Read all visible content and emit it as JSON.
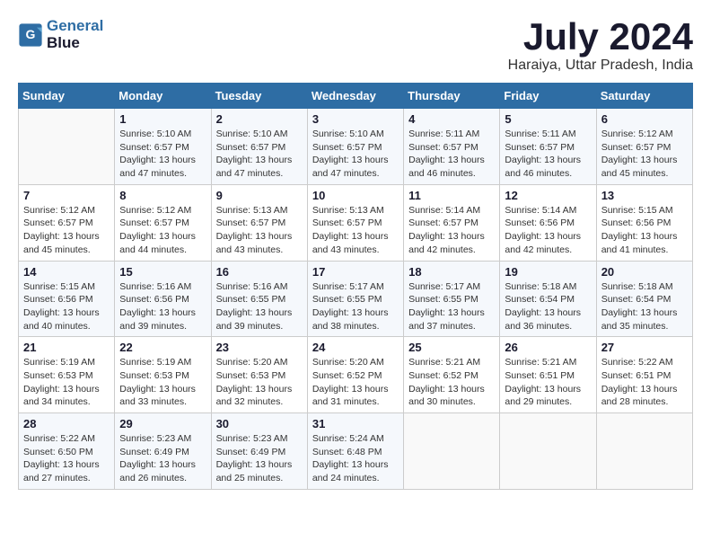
{
  "header": {
    "logo_line1": "General",
    "logo_line2": "Blue",
    "month_year": "July 2024",
    "location": "Haraiya, Uttar Pradesh, India"
  },
  "weekdays": [
    "Sunday",
    "Monday",
    "Tuesday",
    "Wednesday",
    "Thursday",
    "Friday",
    "Saturday"
  ],
  "weeks": [
    [
      {
        "day": "",
        "info": ""
      },
      {
        "day": "1",
        "info": "Sunrise: 5:10 AM\nSunset: 6:57 PM\nDaylight: 13 hours\nand 47 minutes."
      },
      {
        "day": "2",
        "info": "Sunrise: 5:10 AM\nSunset: 6:57 PM\nDaylight: 13 hours\nand 47 minutes."
      },
      {
        "day": "3",
        "info": "Sunrise: 5:10 AM\nSunset: 6:57 PM\nDaylight: 13 hours\nand 47 minutes."
      },
      {
        "day": "4",
        "info": "Sunrise: 5:11 AM\nSunset: 6:57 PM\nDaylight: 13 hours\nand 46 minutes."
      },
      {
        "day": "5",
        "info": "Sunrise: 5:11 AM\nSunset: 6:57 PM\nDaylight: 13 hours\nand 46 minutes."
      },
      {
        "day": "6",
        "info": "Sunrise: 5:12 AM\nSunset: 6:57 PM\nDaylight: 13 hours\nand 45 minutes."
      }
    ],
    [
      {
        "day": "7",
        "info": "Sunrise: 5:12 AM\nSunset: 6:57 PM\nDaylight: 13 hours\nand 45 minutes."
      },
      {
        "day": "8",
        "info": "Sunrise: 5:12 AM\nSunset: 6:57 PM\nDaylight: 13 hours\nand 44 minutes."
      },
      {
        "day": "9",
        "info": "Sunrise: 5:13 AM\nSunset: 6:57 PM\nDaylight: 13 hours\nand 43 minutes."
      },
      {
        "day": "10",
        "info": "Sunrise: 5:13 AM\nSunset: 6:57 PM\nDaylight: 13 hours\nand 43 minutes."
      },
      {
        "day": "11",
        "info": "Sunrise: 5:14 AM\nSunset: 6:57 PM\nDaylight: 13 hours\nand 42 minutes."
      },
      {
        "day": "12",
        "info": "Sunrise: 5:14 AM\nSunset: 6:56 PM\nDaylight: 13 hours\nand 42 minutes."
      },
      {
        "day": "13",
        "info": "Sunrise: 5:15 AM\nSunset: 6:56 PM\nDaylight: 13 hours\nand 41 minutes."
      }
    ],
    [
      {
        "day": "14",
        "info": "Sunrise: 5:15 AM\nSunset: 6:56 PM\nDaylight: 13 hours\nand 40 minutes."
      },
      {
        "day": "15",
        "info": "Sunrise: 5:16 AM\nSunset: 6:56 PM\nDaylight: 13 hours\nand 39 minutes."
      },
      {
        "day": "16",
        "info": "Sunrise: 5:16 AM\nSunset: 6:55 PM\nDaylight: 13 hours\nand 39 minutes."
      },
      {
        "day": "17",
        "info": "Sunrise: 5:17 AM\nSunset: 6:55 PM\nDaylight: 13 hours\nand 38 minutes."
      },
      {
        "day": "18",
        "info": "Sunrise: 5:17 AM\nSunset: 6:55 PM\nDaylight: 13 hours\nand 37 minutes."
      },
      {
        "day": "19",
        "info": "Sunrise: 5:18 AM\nSunset: 6:54 PM\nDaylight: 13 hours\nand 36 minutes."
      },
      {
        "day": "20",
        "info": "Sunrise: 5:18 AM\nSunset: 6:54 PM\nDaylight: 13 hours\nand 35 minutes."
      }
    ],
    [
      {
        "day": "21",
        "info": "Sunrise: 5:19 AM\nSunset: 6:53 PM\nDaylight: 13 hours\nand 34 minutes."
      },
      {
        "day": "22",
        "info": "Sunrise: 5:19 AM\nSunset: 6:53 PM\nDaylight: 13 hours\nand 33 minutes."
      },
      {
        "day": "23",
        "info": "Sunrise: 5:20 AM\nSunset: 6:53 PM\nDaylight: 13 hours\nand 32 minutes."
      },
      {
        "day": "24",
        "info": "Sunrise: 5:20 AM\nSunset: 6:52 PM\nDaylight: 13 hours\nand 31 minutes."
      },
      {
        "day": "25",
        "info": "Sunrise: 5:21 AM\nSunset: 6:52 PM\nDaylight: 13 hours\nand 30 minutes."
      },
      {
        "day": "26",
        "info": "Sunrise: 5:21 AM\nSunset: 6:51 PM\nDaylight: 13 hours\nand 29 minutes."
      },
      {
        "day": "27",
        "info": "Sunrise: 5:22 AM\nSunset: 6:51 PM\nDaylight: 13 hours\nand 28 minutes."
      }
    ],
    [
      {
        "day": "28",
        "info": "Sunrise: 5:22 AM\nSunset: 6:50 PM\nDaylight: 13 hours\nand 27 minutes."
      },
      {
        "day": "29",
        "info": "Sunrise: 5:23 AM\nSunset: 6:49 PM\nDaylight: 13 hours\nand 26 minutes."
      },
      {
        "day": "30",
        "info": "Sunrise: 5:23 AM\nSunset: 6:49 PM\nDaylight: 13 hours\nand 25 minutes."
      },
      {
        "day": "31",
        "info": "Sunrise: 5:24 AM\nSunset: 6:48 PM\nDaylight: 13 hours\nand 24 minutes."
      },
      {
        "day": "",
        "info": ""
      },
      {
        "day": "",
        "info": ""
      },
      {
        "day": "",
        "info": ""
      }
    ]
  ]
}
